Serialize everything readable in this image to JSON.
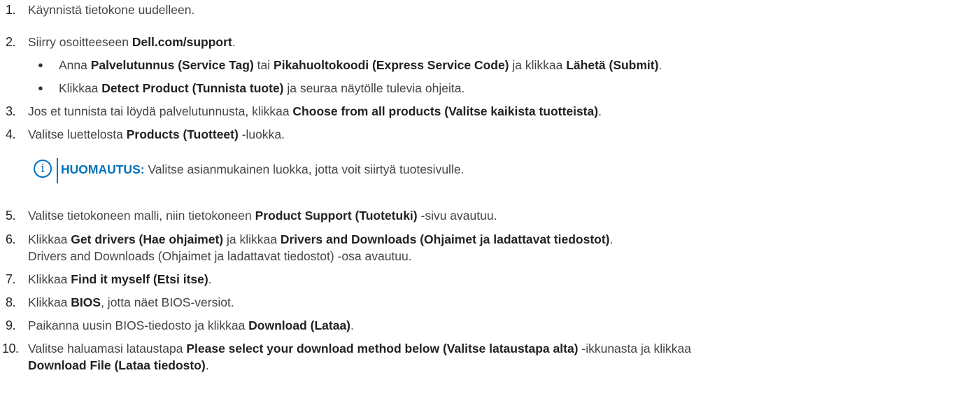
{
  "steps": [
    {
      "num": "1.",
      "parts": [
        [
          "t",
          "Käynnistä tietokone uudelleen."
        ]
      ]
    },
    {
      "num": "2.",
      "parts": [
        [
          "t",
          "Siirry osoitteeseen "
        ],
        [
          "b",
          "Dell.com/support"
        ],
        [
          "t",
          "."
        ]
      ]
    },
    {
      "num": "3.",
      "parts": [
        [
          "t",
          "Jos et tunnista tai löydä palvelutunnusta, klikkaa "
        ],
        [
          "b",
          "Choose from all products (Valitse kaikista tuotteista)"
        ],
        [
          "t",
          "."
        ]
      ]
    },
    {
      "num": "4.",
      "parts": [
        [
          "t",
          "Valitse luettelosta "
        ],
        [
          "b",
          "Products (Tuotteet)"
        ],
        [
          "t",
          " -luokka."
        ]
      ]
    },
    {
      "num": "5.",
      "parts": [
        [
          "t",
          "Valitse tietokoneen malli, niin tietokoneen "
        ],
        [
          "b",
          "Product Support (Tuotetuki)"
        ],
        [
          "t",
          " -sivu avautuu."
        ]
      ]
    },
    {
      "num": "6.",
      "parts": [
        [
          "t",
          "Klikkaa "
        ],
        [
          "b",
          "Get drivers (Hae ohjaimet)"
        ],
        [
          "t",
          " ja klikkaa "
        ],
        [
          "b",
          "Drivers and Downloads (Ohjaimet ja ladattavat tiedostot)"
        ],
        [
          "t",
          "."
        ]
      ],
      "line2": "Drivers and Downloads (Ohjaimet ja ladattavat tiedostot) -osa avautuu."
    },
    {
      "num": "7.",
      "parts": [
        [
          "t",
          "Klikkaa "
        ],
        [
          "b",
          "Find it myself (Etsi itse)"
        ],
        [
          "t",
          "."
        ]
      ]
    },
    {
      "num": "8.",
      "parts": [
        [
          "t",
          "Klikkaa "
        ],
        [
          "b",
          "BIOS"
        ],
        [
          "t",
          ", jotta näet BIOS-versiot."
        ]
      ]
    },
    {
      "num": "9.",
      "parts": [
        [
          "t",
          "Paikanna uusin BIOS-tiedosto ja klikkaa "
        ],
        [
          "b",
          "Download (Lataa)"
        ],
        [
          "t",
          "."
        ]
      ]
    },
    {
      "num": "10.",
      "parts": [
        [
          "t",
          "Valitse haluamasi lataustapa "
        ],
        [
          "b",
          "Please select your download method below (Valitse lataustapa alta)"
        ],
        [
          "t",
          " -ikkunasta ja klikkaa"
        ]
      ],
      "line2parts": [
        [
          "b",
          "Download File (Lataa tiedosto)"
        ],
        [
          "t",
          "."
        ]
      ]
    }
  ],
  "bullets": [
    {
      "parts": [
        [
          "t",
          "Anna "
        ],
        [
          "b",
          "Palvelutunnus (Service Tag)"
        ],
        [
          "t",
          " tai "
        ],
        [
          "b",
          "Pikahuoltokoodi (Express Service Code)"
        ],
        [
          "t",
          " ja klikkaa "
        ],
        [
          "b",
          "Lähetä (Submit)"
        ],
        [
          "t",
          "."
        ]
      ]
    },
    {
      "parts": [
        [
          "t",
          "Klikkaa "
        ],
        [
          "b",
          "Detect Product (Tunnista tuote)"
        ],
        [
          "t",
          " ja seuraa näytölle tulevia ohjeita."
        ]
      ]
    }
  ],
  "bullet_symbol": "●",
  "note": {
    "icon": "info-icon",
    "icon_glyph": "i",
    "label": "HUOMAUTUS:",
    "text": " Valitse asianmukainen luokka, jotta voit siirtyä tuotesivulle.",
    "accent": "#0072bc"
  }
}
